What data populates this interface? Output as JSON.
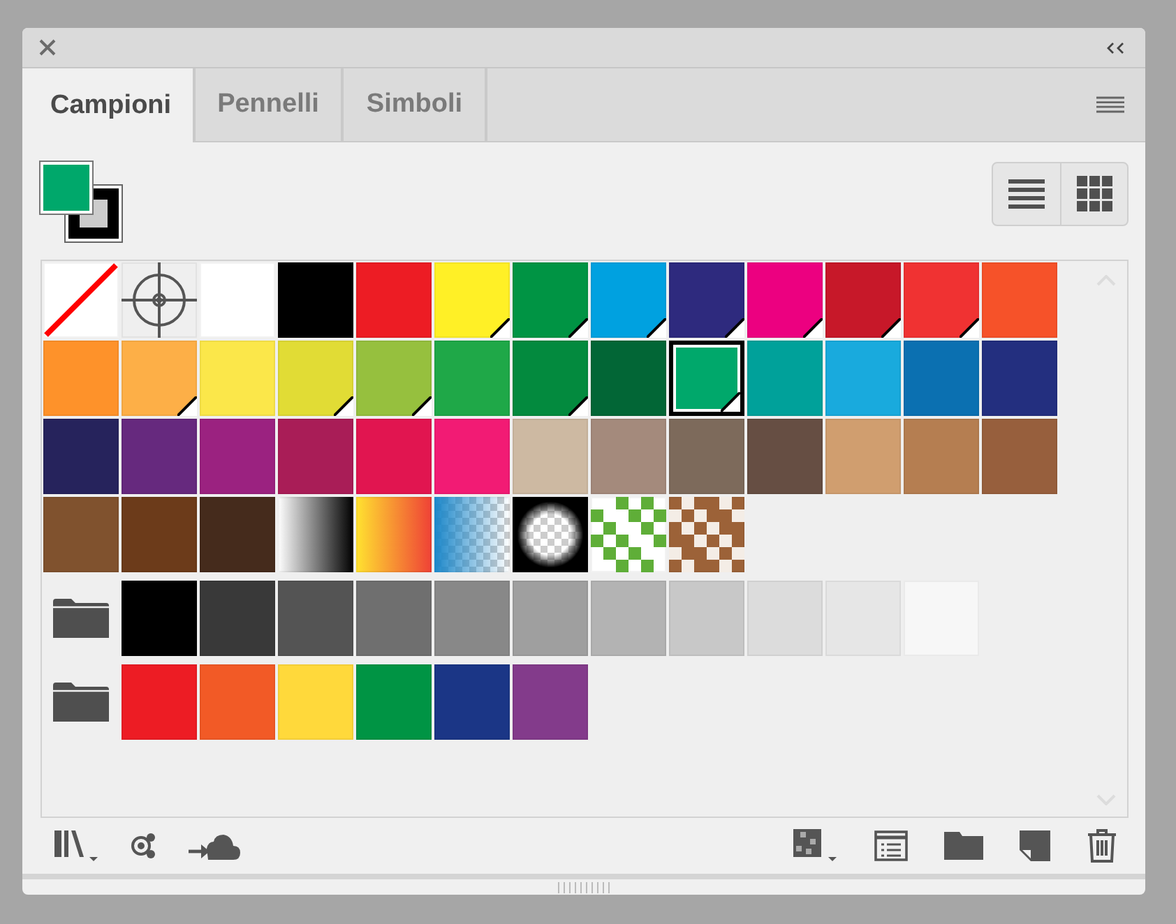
{
  "tabs": [
    {
      "label": "Campioni",
      "selected": true
    },
    {
      "label": "Pennelli",
      "selected": false
    },
    {
      "label": "Simboli",
      "selected": false
    }
  ],
  "fill": {
    "color": "#00a86b"
  },
  "stroke": {
    "color": "#000000"
  },
  "swatch_rows": [
    {
      "kind": "plain",
      "items": [
        {
          "kind": "none"
        },
        {
          "kind": "registration"
        },
        {
          "kind": "color",
          "color": "#ffffff",
          "global": false,
          "selected": false
        },
        {
          "kind": "color",
          "color": "#000000",
          "global": false,
          "selected": false
        },
        {
          "kind": "color",
          "color": "#ed1c24",
          "global": false,
          "selected": false
        },
        {
          "kind": "color",
          "color": "#fff026",
          "global": true,
          "selected": false
        },
        {
          "kind": "color",
          "color": "#009444",
          "global": true,
          "selected": false
        },
        {
          "kind": "color",
          "color": "#00a1e0",
          "global": true,
          "selected": false
        },
        {
          "kind": "color",
          "color": "#2e2a7e",
          "global": true,
          "selected": false
        },
        {
          "kind": "color",
          "color": "#ec0080",
          "global": true,
          "selected": false
        },
        {
          "kind": "color",
          "color": "#c71829",
          "global": true,
          "selected": false
        },
        {
          "kind": "color",
          "color": "#f03232",
          "global": true,
          "selected": false
        },
        {
          "kind": "color",
          "color": "#f65229",
          "global": false,
          "selected": false
        }
      ]
    },
    {
      "kind": "plain",
      "items": [
        {
          "kind": "color",
          "color": "#fe922a",
          "global": false,
          "selected": false
        },
        {
          "kind": "color",
          "color": "#fdaf47",
          "global": true,
          "selected": false
        },
        {
          "kind": "color",
          "color": "#fbe74a",
          "global": false,
          "selected": false
        },
        {
          "kind": "color",
          "color": "#e1dc35",
          "global": true,
          "selected": false
        },
        {
          "kind": "color",
          "color": "#96c03e",
          "global": true,
          "selected": false
        },
        {
          "kind": "color",
          "color": "#1fa848",
          "global": false,
          "selected": false
        },
        {
          "kind": "color",
          "color": "#038a3e",
          "global": true,
          "selected": false
        },
        {
          "kind": "color",
          "color": "#026636",
          "global": false,
          "selected": false
        },
        {
          "kind": "color",
          "color": "#00a86b",
          "global": true,
          "selected": true
        },
        {
          "kind": "color",
          "color": "#00a19a",
          "global": false,
          "selected": false
        },
        {
          "kind": "color",
          "color": "#19aadd",
          "global": false,
          "selected": false
        },
        {
          "kind": "color",
          "color": "#0b70b1",
          "global": false,
          "selected": false
        },
        {
          "kind": "color",
          "color": "#232f7f",
          "global": false,
          "selected": false
        }
      ]
    },
    {
      "kind": "plain",
      "items": [
        {
          "kind": "color",
          "color": "#26235c",
          "global": false,
          "selected": false
        },
        {
          "kind": "color",
          "color": "#66297e",
          "global": false,
          "selected": false
        },
        {
          "kind": "color",
          "color": "#9b2280",
          "global": false,
          "selected": false
        },
        {
          "kind": "color",
          "color": "#a91d57",
          "global": false,
          "selected": false
        },
        {
          "kind": "color",
          "color": "#e11550",
          "global": false,
          "selected": false
        },
        {
          "kind": "color",
          "color": "#f21b74",
          "global": false,
          "selected": false
        },
        {
          "kind": "color",
          "color": "#cdb9a2",
          "global": false,
          "selected": false
        },
        {
          "kind": "color",
          "color": "#a48a7c",
          "global": false,
          "selected": false
        },
        {
          "kind": "color",
          "color": "#7d6a5b",
          "global": false,
          "selected": false
        },
        {
          "kind": "color",
          "color": "#664e43",
          "global": false,
          "selected": false
        },
        {
          "kind": "color",
          "color": "#d09e6f",
          "global": false,
          "selected": false
        },
        {
          "kind": "color",
          "color": "#b57e51",
          "global": false,
          "selected": false
        },
        {
          "kind": "color",
          "color": "#975f3d",
          "global": false,
          "selected": false
        }
      ]
    },
    {
      "kind": "plain",
      "items": [
        {
          "kind": "color",
          "color": "#80522e",
          "global": false,
          "selected": false
        },
        {
          "kind": "color",
          "color": "#6c3b1a",
          "global": false,
          "selected": false
        },
        {
          "kind": "color",
          "color": "#452b1c",
          "global": false,
          "selected": false
        },
        {
          "kind": "gray-gradient"
        },
        {
          "kind": "warm-gradient"
        },
        {
          "kind": "fade-gradient",
          "color": "#1c87c9"
        },
        {
          "kind": "radial-gradient",
          "color": "#000000"
        },
        {
          "kind": "leaf-pattern"
        },
        {
          "kind": "swirl-pattern"
        }
      ]
    },
    {
      "kind": "group",
      "items": [
        {
          "kind": "color",
          "color": "#000000",
          "global": false,
          "selected": false
        },
        {
          "kind": "color",
          "color": "#393939",
          "global": false,
          "selected": false
        },
        {
          "kind": "color",
          "color": "#545454",
          "global": false,
          "selected": false
        },
        {
          "kind": "color",
          "color": "#6f6f6f",
          "global": false,
          "selected": false
        },
        {
          "kind": "color",
          "color": "#888888",
          "global": false,
          "selected": false
        },
        {
          "kind": "color",
          "color": "#9f9f9f",
          "global": false,
          "selected": false
        },
        {
          "kind": "color",
          "color": "#b3b3b3",
          "global": false,
          "selected": false
        },
        {
          "kind": "color",
          "color": "#c8c8c8",
          "global": false,
          "selected": false
        },
        {
          "kind": "color",
          "color": "#dcdcdc",
          "global": false,
          "selected": false
        },
        {
          "kind": "color",
          "color": "#e6e6e6",
          "global": false,
          "selected": false
        },
        {
          "kind": "color",
          "color": "#f7f7f7",
          "global": false,
          "selected": false
        }
      ]
    },
    {
      "kind": "group",
      "items": [
        {
          "kind": "color",
          "color": "#ed1c24",
          "global": false,
          "selected": false
        },
        {
          "kind": "color",
          "color": "#f25a26",
          "global": false,
          "selected": false
        },
        {
          "kind": "color",
          "color": "#ffd93b",
          "global": false,
          "selected": false
        },
        {
          "kind": "color",
          "color": "#009444",
          "global": false,
          "selected": false
        },
        {
          "kind": "color",
          "color": "#1b3686",
          "global": false,
          "selected": false
        },
        {
          "kind": "color",
          "color": "#833b8b",
          "global": false,
          "selected": false
        }
      ]
    }
  ]
}
